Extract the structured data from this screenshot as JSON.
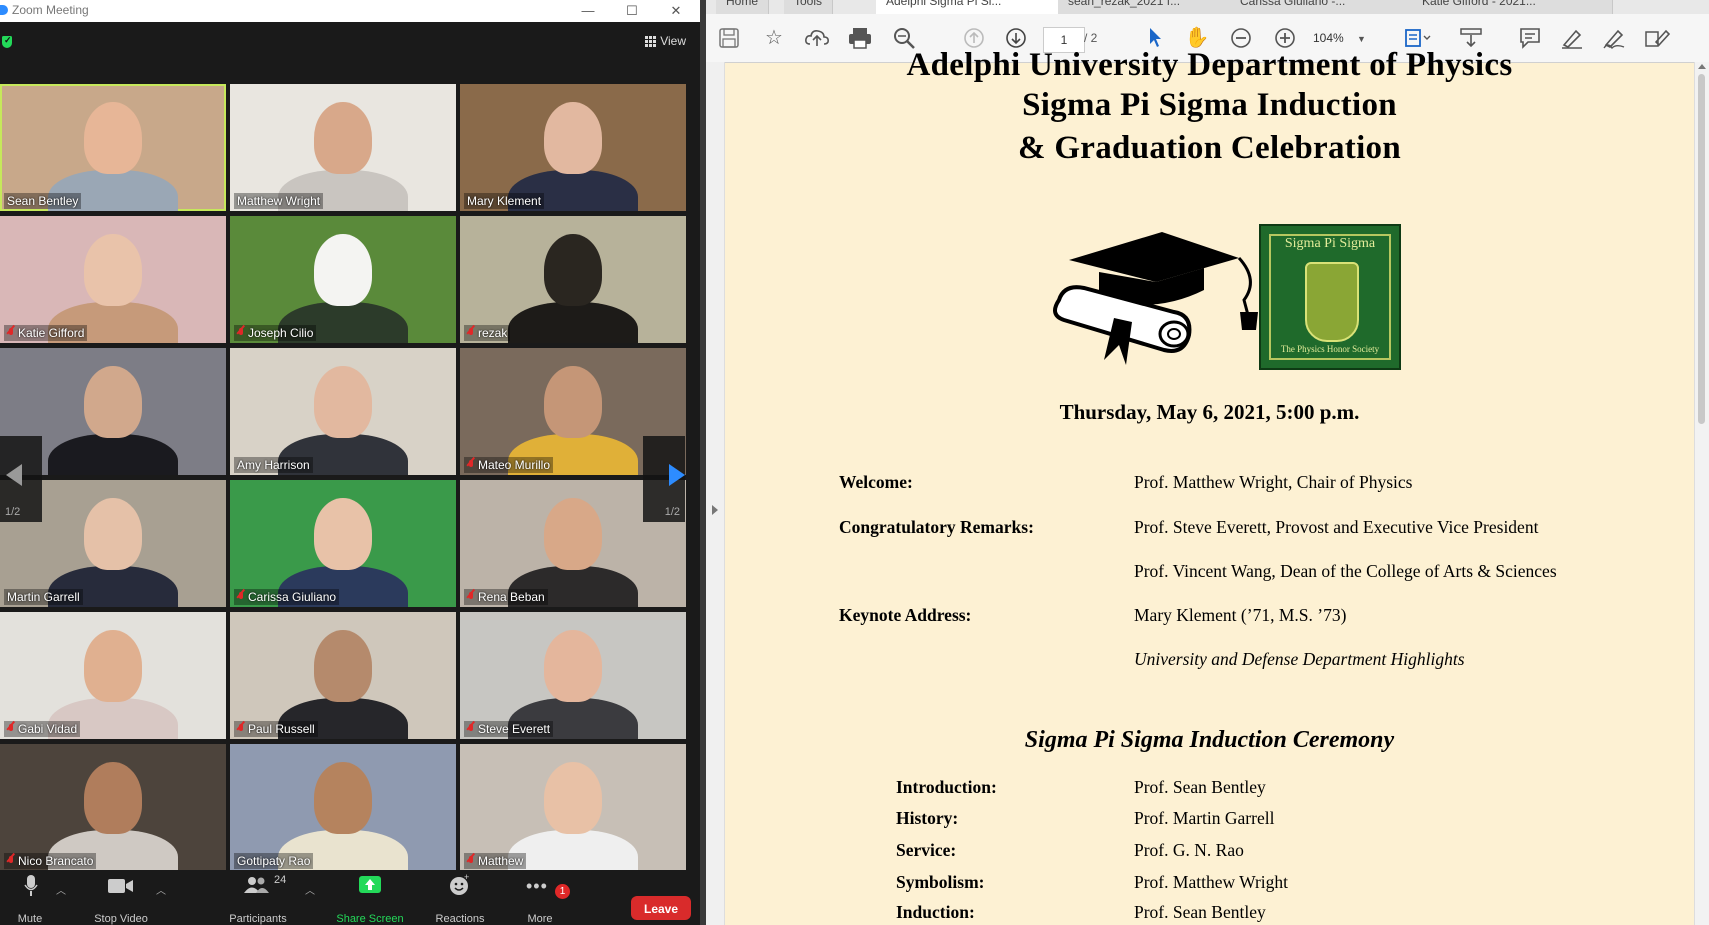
{
  "zoom": {
    "window_title": "Zoom Meeting",
    "view_label": "View",
    "participants": [
      {
        "name": "Sean Bentley",
        "muted": false,
        "active": true,
        "bg": "#c8a88a",
        "skin": "#e7b697",
        "shirt": "#9aa7b5"
      },
      {
        "name": "Matthew Wright",
        "muted": false,
        "active": false,
        "bg": "#e9e6e0",
        "skin": "#d8a88a",
        "shirt": "#c9c5c0"
      },
      {
        "name": "Mary Klement",
        "muted": false,
        "active": false,
        "bg": "#8a6a4a",
        "skin": "#e2b8a0",
        "shirt": "#2a2f45"
      },
      {
        "name": "Katie Gifford",
        "muted": true,
        "active": false,
        "bg": "#d9b7b7",
        "skin": "#e9c3aa",
        "shirt": "#c69a7a"
      },
      {
        "name": "Joseph Cilio",
        "muted": true,
        "active": false,
        "bg": "#5a8a3a",
        "skin": "#f4f4f2",
        "shirt": "#2c3b2a"
      },
      {
        "name": "rezak",
        "muted": true,
        "active": false,
        "bg": "#b7b29a",
        "skin": "#2a2620",
        "shirt": "#1d1b18"
      },
      {
        "name": "",
        "muted": false,
        "active": false,
        "bg": "#7d7d86",
        "skin": "#d1a88c",
        "shirt": "#1a1a1f"
      },
      {
        "name": "Amy Harrison",
        "muted": false,
        "active": false,
        "bg": "#d8d2c7",
        "skin": "#e2b89f",
        "shirt": "#30333a"
      },
      {
        "name": "Mateo Murillo",
        "muted": true,
        "active": false,
        "bg": "#7a6a5c",
        "skin": "#c59677",
        "shirt": "#e0b038"
      },
      {
        "name": "Martin Garrell",
        "muted": false,
        "active": false,
        "bg": "#a8a092",
        "skin": "#e5c1a8",
        "shirt": "#272b3b"
      },
      {
        "name": "Carissa Giuliano",
        "muted": true,
        "active": false,
        "bg": "#3a9a4a",
        "skin": "#e8c2a8",
        "shirt": "#2b3a5c"
      },
      {
        "name": "Rena Beban",
        "muted": true,
        "active": false,
        "bg": "#bcb3a8",
        "skin": "#d8a888",
        "shirt": "#2c2a2a"
      },
      {
        "name": "Gabi Vidad",
        "muted": true,
        "active": false,
        "bg": "#e3e1dc",
        "skin": "#e0b090",
        "shirt": "#d8c8c4"
      },
      {
        "name": "Paul Russell",
        "muted": true,
        "active": false,
        "bg": "#cfc7bb",
        "skin": "#b58a6c",
        "shirt": "#26262a"
      },
      {
        "name": "Steve Everett",
        "muted": true,
        "active": false,
        "bg": "#c7c6c2",
        "skin": "#e4b69c",
        "shirt": "#3b3b3f"
      },
      {
        "name": "Nico Brancato",
        "muted": true,
        "active": false,
        "bg": "#4d443c",
        "skin": "#b07d5c",
        "shirt": "#cfc9c3"
      },
      {
        "name": "Gottipaty Rao",
        "muted": false,
        "active": false,
        "bg": "#8f9ab0",
        "skin": "#b5835e",
        "shirt": "#e9e3cf"
      },
      {
        "name": "Matthew",
        "muted": true,
        "active": false,
        "bg": "#c7bfb6",
        "skin": "#e8c1a6",
        "shirt": "#efefef"
      }
    ],
    "page_indicator": "1/2",
    "toolbar": {
      "mute": "Mute",
      "stop_video": "Stop Video",
      "participants": "Participants",
      "participants_count": "24",
      "share_screen": "Share Screen",
      "reactions": "Reactions",
      "more": "More",
      "more_badge": "1",
      "leave": "Leave"
    }
  },
  "acrobat": {
    "tabs": [
      "Home",
      "Tools",
      "Adelphi Sigma Pi Si...",
      "sean_rezak_2021 f...",
      "Carissa Giuliano -...",
      "Katie Gifford - 2021..."
    ],
    "page_current": "1",
    "page_total": "/ 2",
    "zoom_level": "104%",
    "document": {
      "title_lines": [
        "Adelphi University Department of Physics",
        "Sigma Pi Sigma Induction",
        "& Graduation Celebration"
      ],
      "logo_top": "Sigma Pi Sigma",
      "logo_bottom": "The Physics Honor Society",
      "date": "Thursday, May 6, 2021, 5:00 p.m.",
      "program": [
        {
          "label": "Welcome:",
          "value": "Prof. Matthew Wright, Chair of Physics"
        },
        {
          "label": "Congratulatory Remarks:",
          "value": "Prof. Steve Everett, Provost and Executive Vice President"
        },
        {
          "label": "",
          "value": "Prof. Vincent Wang, Dean of the College of Arts & Sciences"
        },
        {
          "label": "Keynote Address:",
          "value": "Mary Klement (’71, M.S. ’73)"
        },
        {
          "label": "",
          "value": "University and Defense Department Highlights",
          "italic": true
        }
      ],
      "ceremony_title": "Sigma Pi Sigma Induction Ceremony",
      "ceremony": [
        {
          "label": "Introduction:",
          "value": "Prof. Sean Bentley"
        },
        {
          "label": "History:",
          "value": "Prof. Martin Garrell"
        },
        {
          "label": "Service:",
          "value": "Prof. G. N. Rao"
        },
        {
          "label": "Symbolism:",
          "value": "Prof. Matthew Wright"
        },
        {
          "label": "Induction:",
          "value": "Prof. Sean Bentley"
        }
      ]
    }
  }
}
